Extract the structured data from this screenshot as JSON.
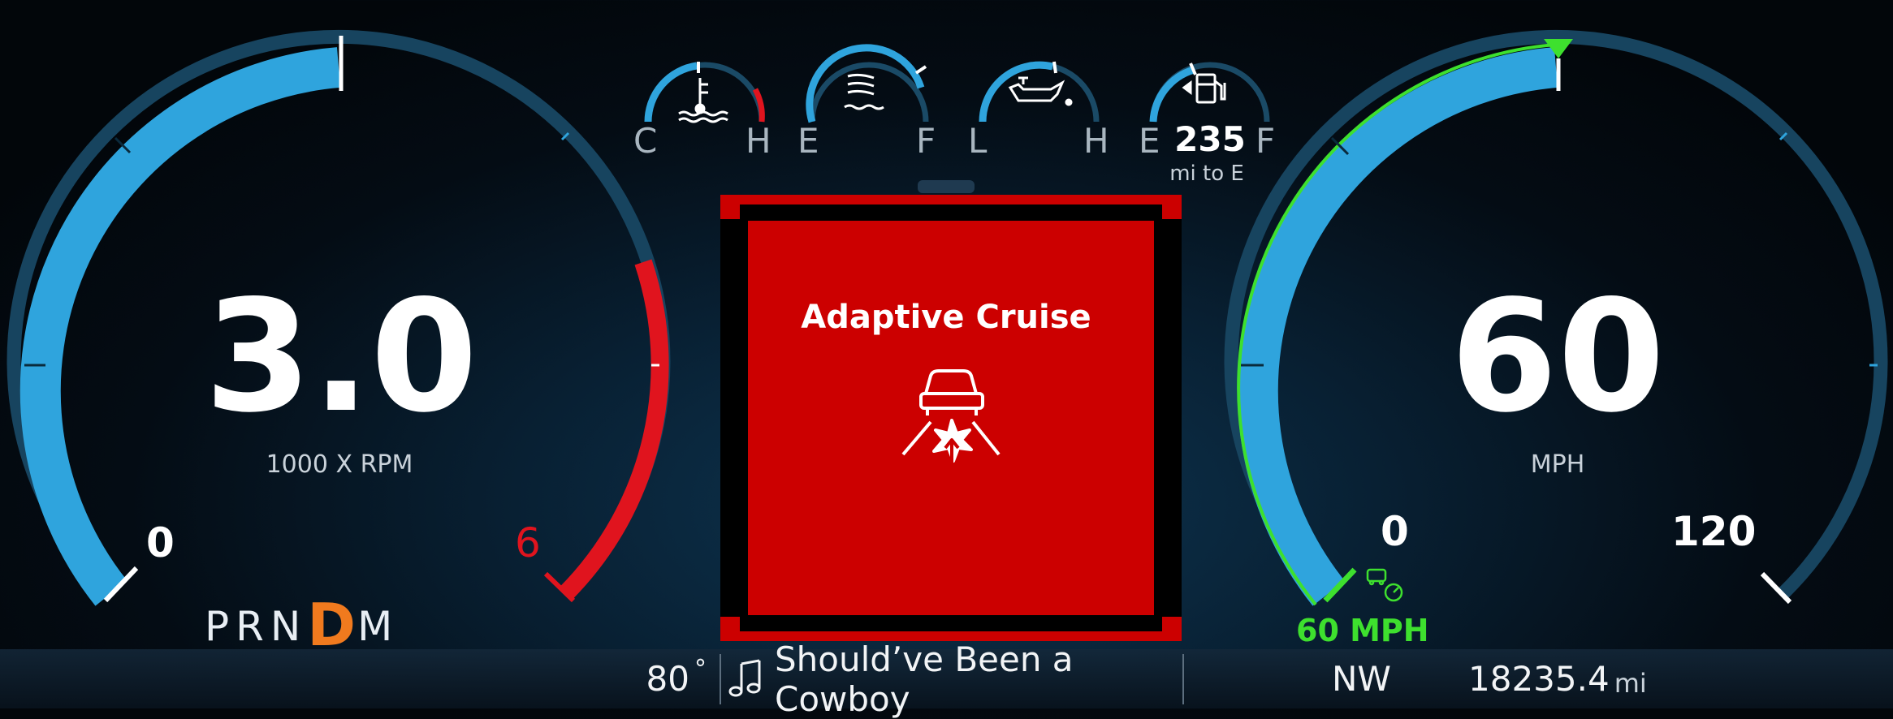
{
  "tachometer": {
    "value": "3.0",
    "unit_label": "1000 X RPM",
    "min_label": "0",
    "max_label": "6",
    "fill_fraction": 0.5,
    "redline_fraction": 0.75
  },
  "speedometer": {
    "value": "60",
    "unit_label": "MPH",
    "min_label": "0",
    "max_label": "120",
    "fill_fraction": 0.5,
    "cruise_set_text": "60 MPH"
  },
  "gauges": {
    "temp": {
      "low": "C",
      "high": "H",
      "icon": "coolant-temp-icon",
      "level": 0.45
    },
    "washer": {
      "low": "E",
      "high": "F",
      "icon": "washer-fluid-icon",
      "level": 0.5
    },
    "oil": {
      "low": "L",
      "high": "H",
      "icon": "oil-pressure-icon",
      "level": 0.55
    },
    "fuel": {
      "low": "E",
      "high": "F",
      "icon": "fuel-pump-icon",
      "range_value": "235",
      "range_unit": "mi to E",
      "level": 0.4
    }
  },
  "alert": {
    "title": "Adaptive Cruise",
    "icon": "adaptive-cruise-collision-icon"
  },
  "gear": {
    "letters_before": "PRN",
    "active": "D",
    "letters_after": "M"
  },
  "bottom_bar": {
    "outside_temp": "80",
    "degree_symbol": "°",
    "song_icon": "music-note-icon",
    "song_title": "Should’ve Been a Cowboy",
    "compass": "NW",
    "odometer_value": "18235.4",
    "odometer_unit": "mi"
  },
  "colors": {
    "gauge_blue": "#2fa4dd",
    "gauge_dark": "#17445f",
    "redline": "#e0141e",
    "cruise_green": "#3ee02e",
    "alert_red": "#cc0000",
    "gear_active": "#f07a1e"
  }
}
